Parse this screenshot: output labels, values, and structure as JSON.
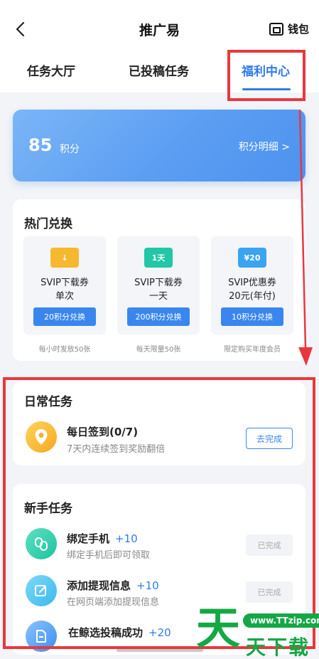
{
  "header": {
    "title": "推广易",
    "wallet_label": "钱包"
  },
  "tabs": [
    {
      "label": "任务大厅",
      "active": false
    },
    {
      "label": "已投稿任务",
      "active": false
    },
    {
      "label": "福利中心",
      "active": true
    }
  ],
  "points": {
    "value": "85",
    "unit": "积分",
    "detail_label": "积分明细 >"
  },
  "hot_exchange": {
    "title": "热门兑换",
    "items": [
      {
        "badge": "↓",
        "name_line1": "SVIP下载券",
        "name_line2": "单次",
        "button": "20积分兑换",
        "note": "每小时发放50张",
        "icon_color": "#f6b82e"
      },
      {
        "badge": "1天",
        "name_line1": "SVIP下载券",
        "name_line2": "一天",
        "button": "200积分兑换",
        "note": "每天限量50张",
        "icon_color": "#21c7a6"
      },
      {
        "badge": "¥20",
        "name_line1": "SVIP优惠券",
        "name_line2": "20元(年付)",
        "button": "10积分兑换",
        "note": "限定购买年度会员",
        "icon_color": "#3aa4f0"
      }
    ]
  },
  "daily_tasks": {
    "title": "日常任务",
    "items": [
      {
        "name": "每日签到(0/7)",
        "desc": "7天内连续签到奖励翻倍",
        "button": "去完成"
      }
    ]
  },
  "newbie_tasks": {
    "title": "新手任务",
    "items": [
      {
        "name": "绑定手机",
        "reward": "+10",
        "desc": "绑定手机后即可领取",
        "button": "已完成"
      },
      {
        "name": "添加提现信息",
        "reward": "+10",
        "desc": "在网页端添加提现信息",
        "button": "已完成"
      },
      {
        "name": "在鲸选投稿成功",
        "reward": "+20",
        "desc": "",
        "button": ""
      }
    ]
  },
  "watermark": {
    "big": "天",
    "site": "www.TTzip.com",
    "sub": "天下载"
  },
  "colors": {
    "accent": "#2f7be9",
    "highlight_red": "#e8383d",
    "watermark_green": "#14a845"
  }
}
